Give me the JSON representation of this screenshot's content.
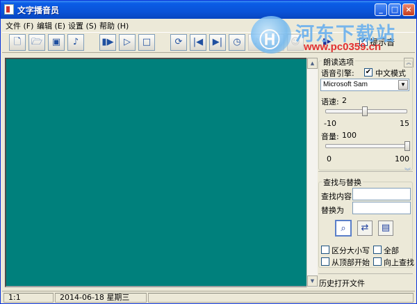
{
  "window": {
    "title": "文字播音员"
  },
  "menu": [
    "文件 (F)",
    "编辑 (E)",
    "设置 (S)",
    "帮助 (H)"
  ],
  "toolbar": {
    "tip_toggle_label": "提示音",
    "tip_toggle_checked": true,
    "extra_glyph": "▮▸"
  },
  "watermark": {
    "site_name": "河东下载站",
    "url": "www.pc0359.cn",
    "logo_text": "Ⓗ"
  },
  "reading": {
    "group_title": "朗读选项",
    "engine_label": "语音引擎:",
    "chinese_mode_label": "中文模式",
    "chinese_mode_checked": true,
    "engine_value": "Microsoft Sam",
    "speed_label": "语速:",
    "speed_value": "2",
    "speed_min": "-10",
    "speed_max": "15",
    "speed_fraction": 0.48,
    "volume_label": "音量:",
    "volume_value": "100",
    "volume_min": "0",
    "volume_max": "100",
    "volume_fraction": 1.0
  },
  "find": {
    "group_title": "查找与替换",
    "find_label": "查找内容",
    "find_value": "",
    "replace_label": "替换为",
    "replace_value": "",
    "case_label": "区分大小写",
    "all_label": "全部",
    "from_top_label": "从顶部开始",
    "search_up_label": "向上查找"
  },
  "history": {
    "label": "历史打开文件"
  },
  "status": {
    "position": "1:1",
    "date": "2014-06-18",
    "weekday": "星期三"
  }
}
